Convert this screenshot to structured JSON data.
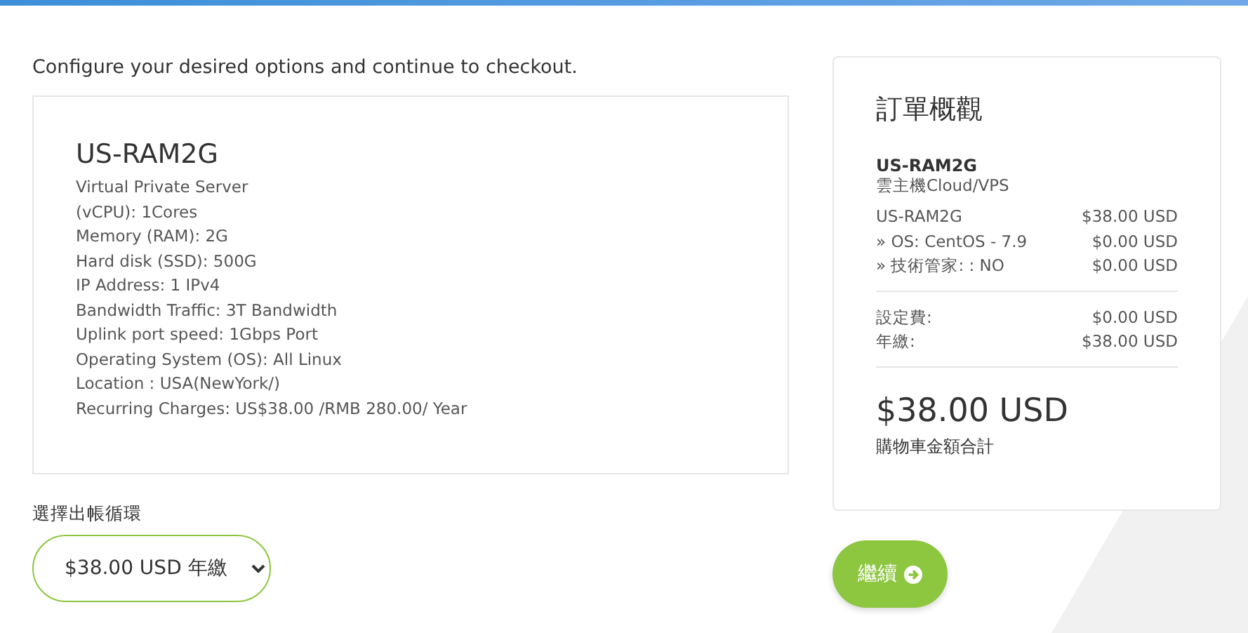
{
  "intro": "Configure your desired options and continue to checkout.",
  "product": {
    "name": "US-RAM2G",
    "lines": [
      "Virtual Private Server",
      "(vCPU): 1Cores",
      "Memory (RAM): 2G",
      "Hard disk (SSD): 500G",
      "IP Address: 1 IPv4",
      "Bandwidth Traffic: 3T Bandwidth",
      "Uplink port speed: 1Gbps Port",
      "Operating System (OS): All Linux",
      "Location : USA(NewYork/)",
      "Recurring Charges: US$38.00 /RMB 280.00/ Year"
    ]
  },
  "billing": {
    "label": "選擇出帳循環",
    "value": "$38.00 USD 年繳"
  },
  "summary": {
    "title": "訂單概觀",
    "product": "US-RAM2G",
    "group": "雲主機Cloud/VPS",
    "items": [
      {
        "label": "US-RAM2G",
        "price": "$38.00 USD"
      },
      {
        "label": "» OS: CentOS - 7.9",
        "price": "$0.00 USD"
      },
      {
        "label": "» 技術管家: : NO",
        "price": "$0.00 USD"
      }
    ],
    "fees": [
      {
        "label": "設定費:",
        "price": "$0.00 USD"
      },
      {
        "label": "年繳:",
        "price": "$38.00 USD"
      }
    ],
    "total": "$38.00 USD",
    "total_label": "購物車金額合計"
  },
  "continue_button": "繼續"
}
